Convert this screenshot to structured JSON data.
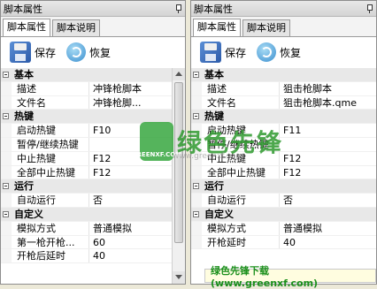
{
  "panels": [
    {
      "title": "脚本属性",
      "tabs": [
        "脚本属性",
        "脚本说明"
      ],
      "toolbar": {
        "save_label": "保存",
        "restore_label": "恢复"
      },
      "rows": [
        {
          "type": "cat",
          "name": "基本"
        },
        {
          "type": "prop",
          "name": "描述",
          "value": "冲锋枪脚本"
        },
        {
          "type": "prop",
          "name": "文件名",
          "value": "冲锋枪脚..."
        },
        {
          "type": "cat",
          "name": "热键"
        },
        {
          "type": "prop",
          "name": "启动热键",
          "value": "F10"
        },
        {
          "type": "prop",
          "name": "暂停/继续热键",
          "value": ""
        },
        {
          "type": "prop",
          "name": "中止热键",
          "value": "F12"
        },
        {
          "type": "prop",
          "name": "全部中止热键",
          "value": "F12"
        },
        {
          "type": "cat",
          "name": "运行"
        },
        {
          "type": "prop",
          "name": "自动运行",
          "value": "否"
        },
        {
          "type": "cat",
          "name": "自定义"
        },
        {
          "type": "prop",
          "name": "模拟方式",
          "value": "普通模拟"
        },
        {
          "type": "prop",
          "name": "第一枪开枪...",
          "value": "60"
        },
        {
          "type": "prop",
          "name": "开枪后延时",
          "value": "40"
        }
      ]
    },
    {
      "title": "脚本属性",
      "tabs": [
        "脚本属性",
        "脚本说明"
      ],
      "toolbar": {
        "save_label": "保存",
        "restore_label": "恢复"
      },
      "rows": [
        {
          "type": "cat",
          "name": "基本"
        },
        {
          "type": "prop",
          "name": "描述",
          "value": "狙击枪脚本"
        },
        {
          "type": "prop",
          "name": "文件名",
          "value": "狙击枪脚本.qme"
        },
        {
          "type": "cat",
          "name": "热键"
        },
        {
          "type": "prop",
          "name": "启动热键",
          "value": "F11"
        },
        {
          "type": "prop",
          "name": "暂停/继续热键",
          "value": ""
        },
        {
          "type": "prop",
          "name": "中止热键",
          "value": "F12"
        },
        {
          "type": "prop",
          "name": "全部中止热键",
          "value": "F12"
        },
        {
          "type": "cat",
          "name": "运行"
        },
        {
          "type": "prop",
          "name": "自动运行",
          "value": "否"
        },
        {
          "type": "cat",
          "name": "自定义"
        },
        {
          "type": "prop",
          "name": "模拟方式",
          "value": "普通模拟"
        },
        {
          "type": "prop",
          "name": "开枪延时",
          "value": "40"
        }
      ]
    }
  ],
  "watermark": {
    "logo_text": "GREENXF.COM",
    "text": "绿色先锋",
    "sub": "www.greenxf.com"
  },
  "banner": {
    "text": "绿色先锋下载(www.greenxf.com)"
  },
  "icons": {
    "save": "floppy-disk-icon",
    "restore": "refresh-icon",
    "pin": "pin-icon"
  }
}
